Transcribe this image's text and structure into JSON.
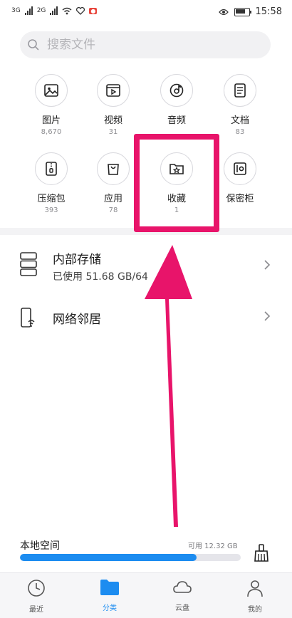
{
  "status_bar": {
    "sim1": "3G",
    "sim2": "2G",
    "time": "15:58"
  },
  "search": {
    "placeholder": "搜索文件"
  },
  "categories": [
    {
      "label": "图片",
      "count": "8,670",
      "icon": "image-icon"
    },
    {
      "label": "视频",
      "count": "31",
      "icon": "video-icon"
    },
    {
      "label": "音频",
      "count": "",
      "icon": "audio-icon"
    },
    {
      "label": "文档",
      "count": "83",
      "icon": "document-icon"
    },
    {
      "label": "压缩包",
      "count": "393",
      "icon": "archive-icon"
    },
    {
      "label": "应用",
      "count": "78",
      "icon": "app-bag-icon"
    },
    {
      "label": "收藏",
      "count": "1",
      "icon": "favorite-folder-icon"
    },
    {
      "label": "保密柜",
      "count": "",
      "icon": "safe-icon"
    }
  ],
  "storage": {
    "internal_title": "内部存储",
    "internal_sub": "已使用 51.68 GB/64",
    "network_title": "网络邻居"
  },
  "local_space": {
    "label": "本地空间",
    "available": "可用 12.32 GB",
    "used_fraction": 0.8
  },
  "tabs": [
    {
      "label": "最近",
      "icon": "clock-icon"
    },
    {
      "label": "分类",
      "icon": "folder-icon",
      "active": true
    },
    {
      "label": "云盘",
      "icon": "cloud-icon"
    },
    {
      "label": "我的",
      "icon": "person-icon"
    }
  ],
  "colors": {
    "accent": "#1c8cf0",
    "annotation": "#e8146a"
  }
}
